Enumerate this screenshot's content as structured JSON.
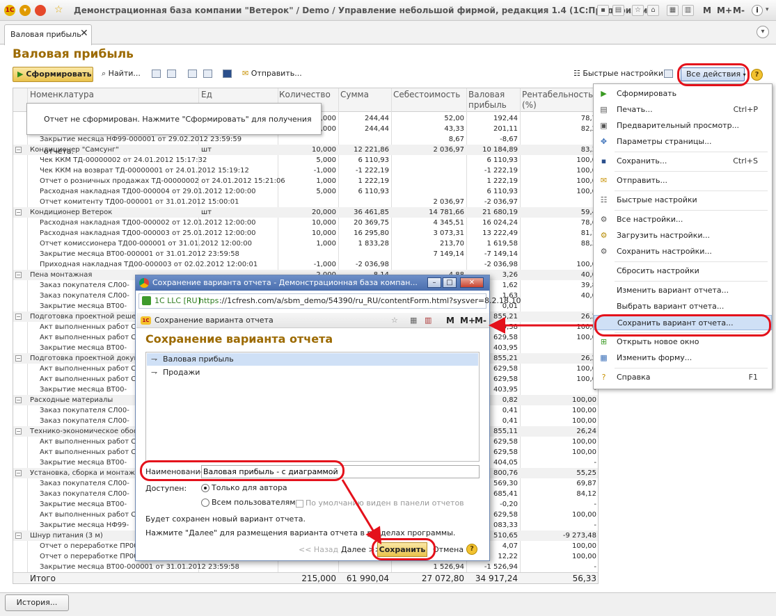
{
  "window": {
    "title": "Демонстрационная база компании \"Ветерок\" / Demo / Управление небольшой фирмой, редакция 1.4 (1С:Предприятие)",
    "m_buttons": [
      "M",
      "M+",
      "M-"
    ],
    "logo_text": "1С"
  },
  "tab": {
    "label": "Валовая прибыль"
  },
  "page": {
    "title": "Валовая прибыль"
  },
  "toolbar": {
    "generate": "Сформировать",
    "find": "Найти...",
    "send": "Отправить...",
    "quick_settings": "Быстрые настройки",
    "all_actions": "Все действия",
    "help": "?"
  },
  "notice": {
    "text": "Отчет не сформирован. Нажмите \"Сформировать\" для получения отчета."
  },
  "grid": {
    "columns": {
      "name": "Номенклатура",
      "unit": "Ед",
      "qty": "Количество",
      "sum": "Сумма",
      "cost": "Себестоимость",
      "profit_l1": "Валовая",
      "profit_l2": "прибыль",
      "rent_l1": "Рентабельность",
      "rent_l2": "(%)"
    },
    "rows": [
      {
        "name": "",
        "unit": "",
        "qty": "1,000",
        "sum": "244,44",
        "cost": "52,00",
        "profit": "192,44",
        "rent": "78,7",
        "grp": false,
        "indent": 1
      },
      {
        "name": "",
        "unit": "",
        "qty": "1,000",
        "sum": "244,44",
        "cost": "43,33",
        "profit": "201,11",
        "rent": "82,2",
        "grp": false,
        "indent": 1
      },
      {
        "name": "Закрытие месяца НФ99-000001 от 29.02.2012 23:59:59",
        "unit": "",
        "qty": "",
        "sum": "",
        "cost": "8,67",
        "profit": "-8,67",
        "rent": "-",
        "grp": false,
        "indent": 1
      },
      {
        "name": "Кондиционер \"Самсунг\"",
        "unit": "шт",
        "qty": "10,000",
        "sum": "12 221,86",
        "cost": "2 036,97",
        "profit": "10 184,89",
        "rent": "83,3",
        "grp": true,
        "indent": 0
      },
      {
        "name": "Чек ККМ ТД-00000002 от 24.01.2012 15:17:32",
        "unit": "",
        "qty": "5,000",
        "sum": "6 110,93",
        "cost": "",
        "profit": "6 110,93",
        "rent": "100,0",
        "grp": false,
        "indent": 1
      },
      {
        "name": "Чек ККМ на возврат ТД-00000001 от 24.01.2012 15:19:12",
        "unit": "",
        "qty": "-1,000",
        "sum": "-1 222,19",
        "cost": "",
        "profit": "-1 222,19",
        "rent": "100,0",
        "grp": false,
        "indent": 1
      },
      {
        "name": "Отчет о розничных продажах ТД-00000002 от 24.01.2012 15:21:06",
        "unit": "",
        "qty": "1,000",
        "sum": "1 222,19",
        "cost": "",
        "profit": "1 222,19",
        "rent": "100,0",
        "grp": false,
        "indent": 1
      },
      {
        "name": "Расходная накладная ТД00-000004 от 29.01.2012 12:00:00",
        "unit": "",
        "qty": "5,000",
        "sum": "6 110,93",
        "cost": "",
        "profit": "6 110,93",
        "rent": "100,0",
        "grp": false,
        "indent": 1
      },
      {
        "name": "Отчет комитенту ТД00-000001 от 31.01.2012 15:00:01",
        "unit": "",
        "qty": "",
        "sum": "",
        "cost": "2 036,97",
        "profit": "-2 036,97",
        "rent": "-",
        "grp": false,
        "indent": 1
      },
      {
        "name": "Кондиционер Ветерок",
        "unit": "шт",
        "qty": "20,000",
        "sum": "36 461,85",
        "cost": "14 781,66",
        "profit": "21 680,19",
        "rent": "59,4",
        "grp": true,
        "indent": 0
      },
      {
        "name": "Расходная накладная ТД00-000002 от 12.01.2012 12:00:00",
        "unit": "",
        "qty": "10,000",
        "sum": "20 369,75",
        "cost": "4 345,51",
        "profit": "16 024,24",
        "rent": "78,6",
        "grp": false,
        "indent": 1
      },
      {
        "name": "Расходная накладная ТД00-000003 от 25.01.2012 12:00:00",
        "unit": "",
        "qty": "10,000",
        "sum": "16 295,80",
        "cost": "3 073,31",
        "profit": "13 222,49",
        "rent": "81,1",
        "grp": false,
        "indent": 1
      },
      {
        "name": "Отчет комиссионера ТД00-000001 от 31.01.2012 12:00:00",
        "unit": "",
        "qty": "1,000",
        "sum": "1 833,28",
        "cost": "213,70",
        "profit": "1 619,58",
        "rent": "88,3",
        "grp": false,
        "indent": 1
      },
      {
        "name": "Закрытие месяца ВТ00-000001 от 31.01.2012 23:59:58",
        "unit": "",
        "qty": "",
        "sum": "",
        "cost": "7 149,14",
        "profit": "-7 149,14",
        "rent": "-",
        "grp": false,
        "indent": 1
      },
      {
        "name": "Приходная накладная ТД00-000003 от 02.02.2012 12:00:01",
        "unit": "",
        "qty": "-1,000",
        "sum": "-2 036,98",
        "cost": "",
        "profit": "-2 036,98",
        "rent": "100,0",
        "grp": false,
        "indent": 1
      },
      {
        "name": "Пена монтажная",
        "unit": "",
        "qty": "2,000",
        "sum": "8,14",
        "cost": "4,88",
        "profit": "3,26",
        "rent": "40,0",
        "grp": true,
        "indent": 0
      },
      {
        "name": "Заказ покупателя СЛ00-",
        "unit": "",
        "qty": "",
        "sum": "",
        "cost": "",
        "profit": "1,62",
        "rent": "39,8",
        "grp": false,
        "indent": 1
      },
      {
        "name": "Заказ покупателя СЛ00-",
        "unit": "",
        "qty": "",
        "sum": "",
        "cost": "",
        "profit": "1,63",
        "rent": "40,0",
        "grp": false,
        "indent": 1
      },
      {
        "name": "Закрытие месяца ВТ00-",
        "unit": "",
        "qty": "",
        "sum": "",
        "cost": "",
        "profit": "0,01",
        "rent": "-",
        "grp": false,
        "indent": 1
      },
      {
        "name": "Подготовка проектной решен",
        "unit": "",
        "qty": "",
        "sum": "",
        "cost": "",
        "profit": "855,21",
        "rent": "26,2",
        "grp": true,
        "indent": 0
      },
      {
        "name": "Акт выполненных работ С",
        "unit": "",
        "qty": "",
        "sum": "",
        "cost": "",
        "profit": "629,58",
        "rent": "100,0",
        "grp": false,
        "indent": 1
      },
      {
        "name": "Акт выполненных работ С",
        "unit": "",
        "qty": "",
        "sum": "",
        "cost": "",
        "profit": "629,58",
        "rent": "100,0",
        "grp": false,
        "indent": 1
      },
      {
        "name": "Закрытие месяца ВТ00-",
        "unit": "",
        "qty": "",
        "sum": "",
        "cost": "",
        "profit": "403,95",
        "rent": "-",
        "grp": false,
        "indent": 1
      },
      {
        "name": "Подготовка проектной докум",
        "unit": "",
        "qty": "",
        "sum": "",
        "cost": "",
        "profit": "855,21",
        "rent": "26,2",
        "grp": true,
        "indent": 0
      },
      {
        "name": "Акт выполненных работ С",
        "unit": "",
        "qty": "",
        "sum": "",
        "cost": "",
        "profit": "629,58",
        "rent": "100,0",
        "grp": false,
        "indent": 1
      },
      {
        "name": "Акт выполненных работ С",
        "unit": "",
        "qty": "",
        "sum": "",
        "cost": "",
        "profit": "629,58",
        "rent": "100,0",
        "grp": false,
        "indent": 1
      },
      {
        "name": "Закрытие месяца ВТ00-",
        "unit": "",
        "qty": "",
        "sum": "",
        "cost": "",
        "profit": "403,95",
        "rent": "-",
        "grp": false,
        "indent": 1
      },
      {
        "name": "Расходные материалы",
        "unit": "",
        "qty": "",
        "sum": "",
        "cost": "",
        "profit": "0,82",
        "rent": "100,00",
        "grp": true,
        "indent": 0
      },
      {
        "name": "Заказ покупателя СЛ00-",
        "unit": "",
        "qty": "",
        "sum": "",
        "cost": "",
        "profit": "0,41",
        "rent": "100,00",
        "grp": false,
        "indent": 1
      },
      {
        "name": "Заказ покупателя СЛ00-",
        "unit": "",
        "qty": "",
        "sum": "",
        "cost": "",
        "profit": "0,41",
        "rent": "100,00",
        "grp": false,
        "indent": 1
      },
      {
        "name": "Технико-экономическое обос",
        "unit": "",
        "qty": "",
        "sum": "",
        "cost": "",
        "profit": "855,11",
        "rent": "26,24",
        "grp": true,
        "indent": 0
      },
      {
        "name": "Акт выполненных работ С",
        "unit": "",
        "qty": "",
        "sum": "",
        "cost": "",
        "profit": "629,58",
        "rent": "100,00",
        "grp": false,
        "indent": 1
      },
      {
        "name": "Акт выполненных работ С",
        "unit": "",
        "qty": "",
        "sum": "",
        "cost": "",
        "profit": "629,58",
        "rent": "100,00",
        "grp": false,
        "indent": 1
      },
      {
        "name": "Закрытие месяца ВТ00-",
        "unit": "",
        "qty": "",
        "sum": "",
        "cost": "",
        "profit": "404,05",
        "rent": "-",
        "grp": false,
        "indent": 1
      },
      {
        "name": "Установка, сборка и монтаж",
        "unit": "",
        "qty": "",
        "sum": "",
        "cost": "",
        "profit": "800,76",
        "rent": "55,25",
        "grp": true,
        "indent": 0
      },
      {
        "name": "Заказ покупателя СЛ00-",
        "unit": "",
        "qty": "",
        "sum": "",
        "cost": "",
        "profit": "569,30",
        "rent": "69,87",
        "grp": false,
        "indent": 1
      },
      {
        "name": "Заказ покупателя СЛ00-",
        "unit": "",
        "qty": "",
        "sum": "",
        "cost": "",
        "profit": "685,41",
        "rent": "84,12",
        "grp": false,
        "indent": 1
      },
      {
        "name": "Закрытие месяца ВТ00-",
        "unit": "",
        "qty": "",
        "sum": "",
        "cost": "",
        "profit": "-0,20",
        "rent": "-",
        "grp": false,
        "indent": 1
      },
      {
        "name": "Акт выполненных работ С",
        "unit": "",
        "qty": "",
        "sum": "",
        "cost": "",
        "profit": "629,58",
        "rent": "100,00",
        "grp": false,
        "indent": 1
      },
      {
        "name": "Закрытие месяца НФ99-",
        "unit": "",
        "qty": "",
        "sum": "",
        "cost": "",
        "profit": "083,33",
        "rent": "-",
        "grp": false,
        "indent": 1
      },
      {
        "name": "Шнур питания (3 м)",
        "unit": "",
        "qty": "",
        "sum": "",
        "cost": "",
        "profit": "510,65",
        "rent": "-9 273,48",
        "grp": true,
        "indent": 0
      },
      {
        "name": "Отчет о переработке ПР00",
        "unit": "",
        "qty": "",
        "sum": "",
        "cost": "",
        "profit": "4,07",
        "rent": "100,00",
        "grp": false,
        "indent": 1
      },
      {
        "name": "Отчет о переработке ПР00",
        "unit": "",
        "qty": "",
        "sum": "",
        "cost": "",
        "profit": "12,22",
        "rent": "100,00",
        "grp": false,
        "indent": 1
      },
      {
        "name": "Закрытие месяца ВТ00-000001 от 31.01.2012 23:59:58",
        "unit": "",
        "qty": "",
        "sum": "",
        "cost": "1 526,94",
        "profit": "-1 526,94",
        "rent": "-",
        "grp": false,
        "indent": 1
      }
    ],
    "total": {
      "label": "Итого",
      "qty": "215,000",
      "sum": "61 990,04",
      "cost": "27 072,80",
      "profit": "34 917,24",
      "rent": "56,33"
    }
  },
  "menu": {
    "items": [
      {
        "label": "Сформировать",
        "shortcut": "",
        "icon": "play-icon",
        "glyph": "▶",
        "color": "#3a9a22",
        "sep_after": false
      },
      {
        "label": "Печать...",
        "shortcut": "Ctrl+P",
        "icon": "print-icon",
        "glyph": "▤",
        "color": "#555555",
        "sep_after": false
      },
      {
        "label": "Предварительный просмотр...",
        "shortcut": "",
        "icon": "preview-icon",
        "glyph": "▣",
        "color": "#555555",
        "sep_after": false
      },
      {
        "label": "Параметры страницы...",
        "shortcut": "",
        "icon": "page-setup-icon",
        "glyph": "✥",
        "color": "#3a6fb8",
        "sep_after": true
      },
      {
        "label": "Сохранить...",
        "shortcut": "Ctrl+S",
        "icon": "save-icon",
        "glyph": "▪",
        "color": "#2b4f8c",
        "sep_after": true
      },
      {
        "label": "Отправить...",
        "shortcut": "",
        "icon": "mail-icon",
        "glyph": "✉",
        "color": "#c79000",
        "sep_after": true
      },
      {
        "label": "Быстрые настройки",
        "shortcut": "",
        "icon": "quick-settings-icon",
        "glyph": "☷",
        "color": "#555555",
        "sep_after": true
      },
      {
        "label": "Все настройки...",
        "shortcut": "",
        "icon": "settings-icon",
        "glyph": "⚙",
        "color": "#555555",
        "sep_after": false
      },
      {
        "label": "Загрузить настройки...",
        "shortcut": "",
        "icon": "load-settings-icon",
        "glyph": "⚙",
        "color": "#b58a00",
        "sep_after": false
      },
      {
        "label": "Сохранить настройки...",
        "shortcut": "",
        "icon": "save-settings-icon",
        "glyph": "⚙",
        "color": "#555555",
        "sep_after": true
      },
      {
        "label": "Сбросить настройки",
        "shortcut": "",
        "icon": "",
        "glyph": "",
        "color": "#555555",
        "sep_after": true
      },
      {
        "label": "Изменить вариант отчета...",
        "shortcut": "",
        "icon": "",
        "glyph": "",
        "color": "#555555",
        "sep_after": false
      },
      {
        "label": "Выбрать вариант отчета...",
        "shortcut": "",
        "icon": "",
        "glyph": "",
        "color": "#555555",
        "sep_after": false
      },
      {
        "label": "Сохранить вариант отчета...",
        "shortcut": "",
        "icon": "",
        "glyph": "",
        "color": "#555555",
        "sep_after": true,
        "highlight": true
      },
      {
        "label": "Открыть новое окно",
        "shortcut": "",
        "icon": "new-window-icon",
        "glyph": "⊞",
        "color": "#3a9a22",
        "sep_after": false
      },
      {
        "label": "Изменить форму...",
        "shortcut": "",
        "icon": "edit-form-icon",
        "glyph": "▦",
        "color": "#3a6fb8",
        "sep_after": true
      },
      {
        "label": "Справка",
        "shortcut": "F1",
        "icon": "help-icon",
        "glyph": "?",
        "color": "#c79000",
        "sep_after": false
      }
    ]
  },
  "dialog": {
    "window_title": "Сохранение варианта отчета - Демонстрационная база компан...",
    "ssl_label": "1C LLC [RU]",
    "url_https": "https",
    "url_rest": "://1cfresh.com/a/sbm_demo/54390/ru_RU/contentForm.html?sysver=8.2.18.10",
    "inner_title": "Сохранение варианта отчета",
    "heading": "Сохранение варианта отчета",
    "variants": [
      "Валовая прибыль",
      "Продажи"
    ],
    "name_label": "Наименование:",
    "name_value": "Валовая прибыль - с диаграммой",
    "access_label": "Доступен:",
    "radio_author": "Только для автора",
    "radio_all": "Всем пользователям",
    "checkbox_default": "По умолчанию виден в панели отчетов",
    "info1": "Будет сохранен новый вариант отчета.",
    "info2": "Нажмите \"Далее\" для размещения варианта отчета в разделах программы.",
    "back": "<< Назад",
    "next": "Далее >>",
    "save": "Сохранить",
    "cancel": "Отмена",
    "help": "?"
  },
  "bottom": {
    "history": "История..."
  },
  "colors": {
    "accent": "#9c6a00",
    "annotation": "#e4111b",
    "highlight": "#cfe0f6"
  }
}
